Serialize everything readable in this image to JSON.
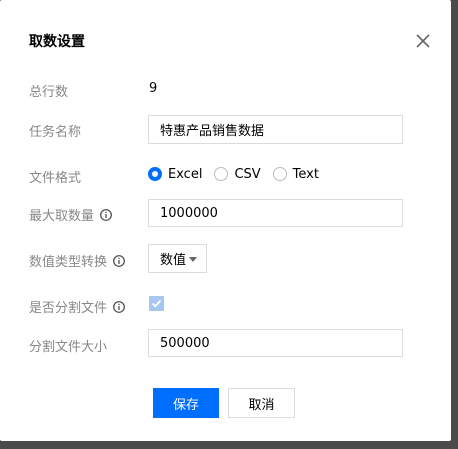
{
  "dialog": {
    "title": "取数设置",
    "close_icon": "close-icon"
  },
  "form": {
    "total_rows": {
      "label": "总行数",
      "value": "9"
    },
    "task_name": {
      "label": "任务名称",
      "value": "特惠产品销售数据"
    },
    "file_format": {
      "label": "文件格式",
      "options": [
        "Excel",
        "CSV",
        "Text"
      ],
      "selected": "Excel"
    },
    "max_count": {
      "label": "最大取数量",
      "value": "1000000",
      "icon": "info-icon"
    },
    "data_type_conversion": {
      "label": "数值类型转换",
      "value": "数值",
      "icon": "info-icon"
    },
    "split_file": {
      "label": "是否分割文件",
      "checked": true,
      "icon": "info-icon"
    },
    "split_size": {
      "label": "分割文件大小",
      "value": "500000"
    }
  },
  "buttons": {
    "save": "保存",
    "cancel": "取消"
  },
  "colors": {
    "primary": "#006eff",
    "label": "#888888",
    "border": "#dcdcdc",
    "checkbox_disabled": "#a7c6f0",
    "overlay": "#4a4a4a"
  }
}
